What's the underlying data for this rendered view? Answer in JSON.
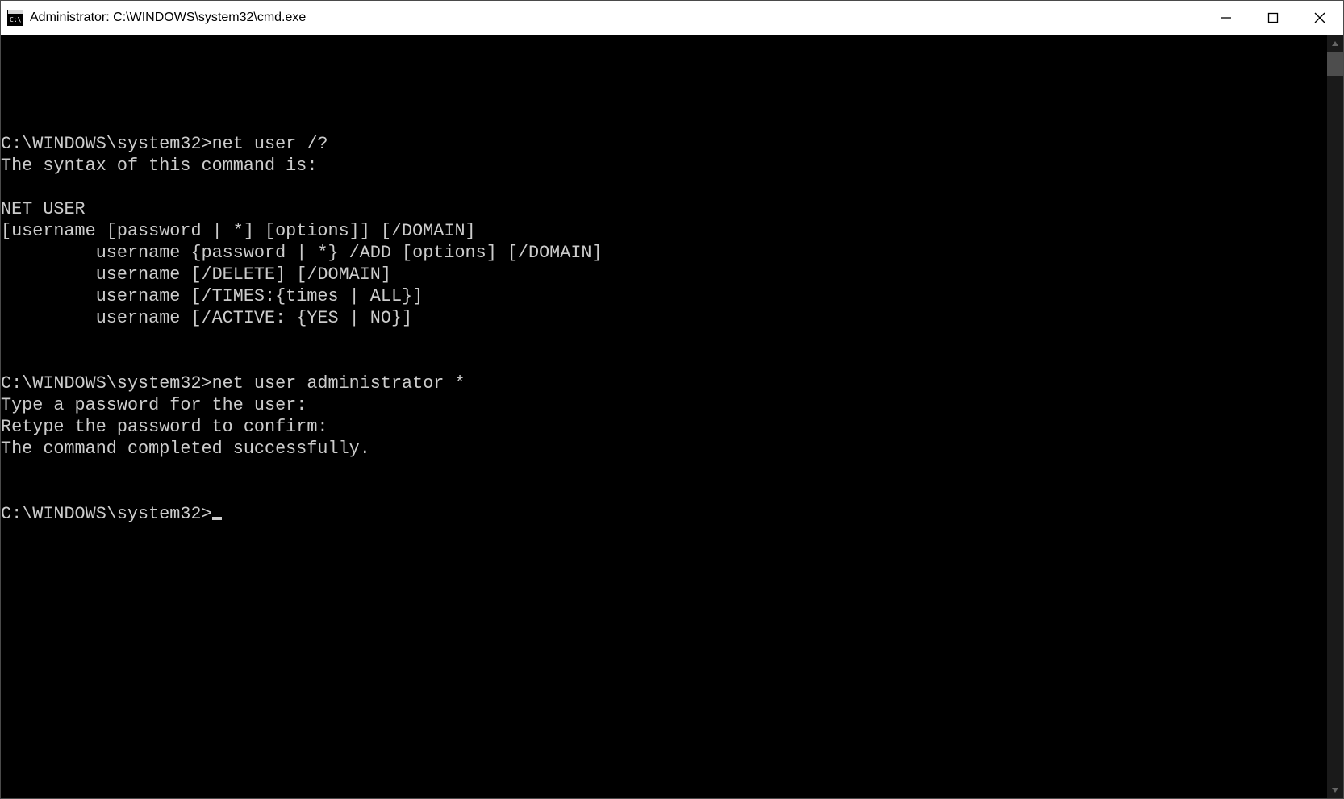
{
  "window": {
    "title": "Administrator: C:\\WINDOWS\\system32\\cmd.exe"
  },
  "terminal": {
    "lines": [
      "",
      "C:\\WINDOWS\\system32>net user /?",
      "The syntax of this command is:",
      "",
      "NET USER",
      "[username [password | *] [options]] [/DOMAIN]",
      "         username {password | *} /ADD [options] [/DOMAIN]",
      "         username [/DELETE] [/DOMAIN]",
      "         username [/TIMES:{times | ALL}]",
      "         username [/ACTIVE: {YES | NO}]",
      "",
      "",
      "C:\\WINDOWS\\system32>net user administrator *",
      "Type a password for the user:",
      "Retype the password to confirm:",
      "The command completed successfully.",
      "",
      ""
    ],
    "current_prompt": "C:\\WINDOWS\\system32>"
  }
}
